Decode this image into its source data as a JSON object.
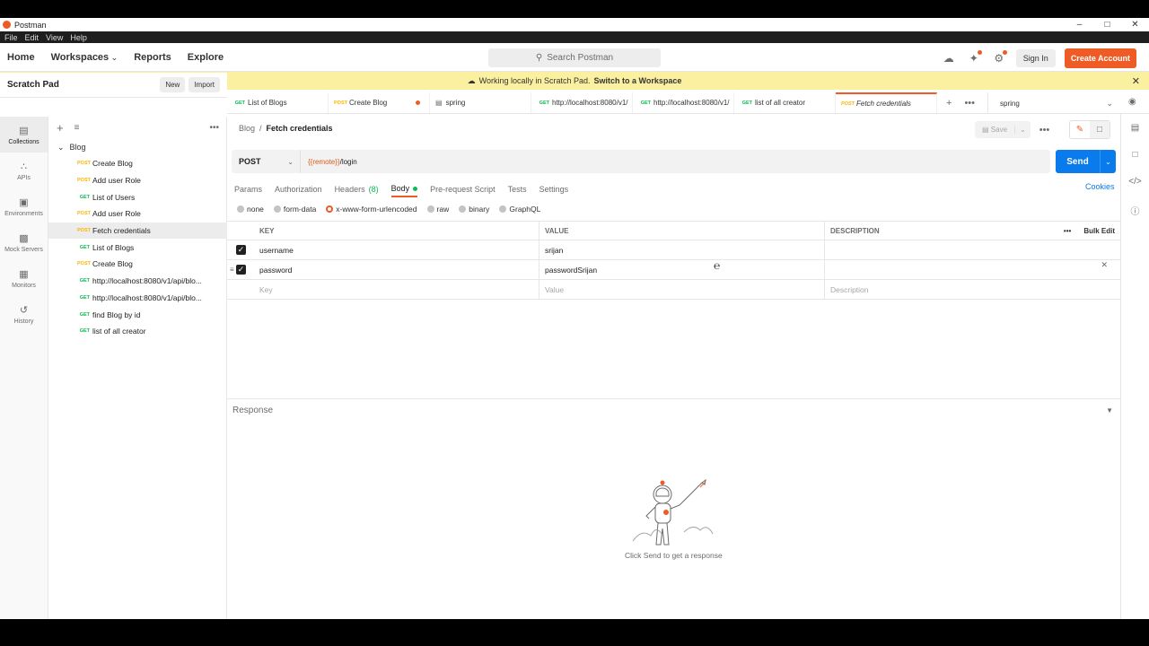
{
  "window": {
    "title": "Postman",
    "controls": [
      "–",
      "□",
      "✕"
    ]
  },
  "menu": [
    "File",
    "Edit",
    "View",
    "Help"
  ],
  "topnav": {
    "home": "Home",
    "workspaces": "Workspaces",
    "reports": "Reports",
    "explore": "Explore",
    "search_placeholder": "Search Postman",
    "sign_in": "Sign In",
    "create_account": "Create Account"
  },
  "banner": {
    "text": "Working locally in Scratch Pad.",
    "link": "Switch to a Workspace"
  },
  "rail": [
    "Collections",
    "APIs",
    "Environments",
    "Mock Servers",
    "Monitors",
    "History"
  ],
  "sidebar": {
    "title": "Scratch Pad",
    "new": "New",
    "import": "Import",
    "folder": "Blog",
    "items": [
      {
        "method": "POST",
        "name": "Create Blog"
      },
      {
        "method": "POST",
        "name": "Add user Role"
      },
      {
        "method": "GET",
        "name": "List of Users"
      },
      {
        "method": "POST",
        "name": "Add user Role"
      },
      {
        "method": "POST",
        "name": "Fetch credentials"
      },
      {
        "method": "GET",
        "name": "List of Blogs"
      },
      {
        "method": "POST",
        "name": "Create Blog"
      },
      {
        "method": "GET",
        "name": "http://localhost:8080/v1/api/blo..."
      },
      {
        "method": "GET",
        "name": "http://localhost:8080/v1/api/blo..."
      },
      {
        "method": "GET",
        "name": "find Blog by id"
      },
      {
        "method": "GET",
        "name": "list of all creator"
      }
    ]
  },
  "tabs": [
    {
      "method": "GET",
      "name": "List of Blogs"
    },
    {
      "method": "POST",
      "name": "Create Blog"
    },
    {
      "method": "",
      "name": "spring"
    },
    {
      "method": "GET",
      "name": "http://localhost:8080/v1/"
    },
    {
      "method": "GET",
      "name": "http://localhost:8080/v1/"
    },
    {
      "method": "GET",
      "name": "list of all creator"
    },
    {
      "method": "POST",
      "name": "Fetch credentials"
    }
  ],
  "environment": "spring",
  "request": {
    "breadcrumb_root": "Blog",
    "breadcrumb_sep": "/",
    "breadcrumb_current": "Fetch credentials",
    "save": "Save",
    "method": "POST",
    "url_var": "{{remote}}",
    "url_path": "/login",
    "send": "Send",
    "tabs": {
      "params": "Params",
      "authorization": "Authorization",
      "headers": "Headers",
      "headers_count": "(8)",
      "body": "Body",
      "prerequest": "Pre-request Script",
      "tests": "Tests",
      "settings": "Settings"
    },
    "cookies": "Cookies",
    "body_types": [
      "none",
      "form-data",
      "x-www-form-urlencoded",
      "raw",
      "binary",
      "GraphQL"
    ],
    "table": {
      "headers": {
        "key": "KEY",
        "value": "VALUE",
        "description": "DESCRIPTION",
        "bulk_edit": "Bulk Edit"
      },
      "rows": [
        {
          "key": "username",
          "value": "srijan"
        },
        {
          "key": "password",
          "value": "passwordSrijan"
        }
      ],
      "placeholders": {
        "key": "Key",
        "value": "Value",
        "description": "Description"
      }
    }
  },
  "response": {
    "title": "Response",
    "hint": "Click Send to get a response"
  }
}
